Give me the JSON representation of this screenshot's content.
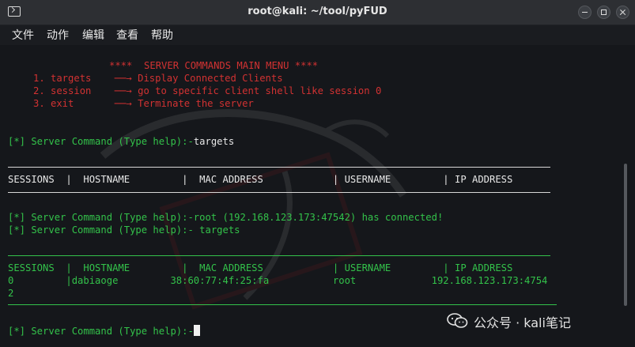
{
  "window": {
    "title": "root@kali: ~/tool/pyFUD"
  },
  "menu": [
    "文件",
    "动作",
    "编辑",
    "查看",
    "帮助"
  ],
  "terminal": {
    "banner": "****  SERVER COMMANDS MAIN MENU ****",
    "menu_options": [
      {
        "label": "1. targets  ",
        "arrow": "──→",
        "desc": "Display Connected Clients"
      },
      {
        "label": "2. session  ",
        "arrow": "──→",
        "desc": "go to specific client shell like session 0"
      },
      {
        "label": "3. exit     ",
        "arrow": "──→",
        "desc": "Terminate the server"
      }
    ],
    "prompt": "[*] Server Command (Type help):-",
    "cmd1": "targets",
    "header_row": "SESSIONS  |  HOSTNAME         |  MAC ADDRESS            | USERNAME         | IP ADDRESS",
    "connected_msg": "[*] Server Command (Type help):-root (192.168.123.173:47542) has connected!",
    "cmd2": " targets",
    "data_row_1": "0         |dabiaoge         38:60:77:4f:25:fa           root             192.168.123.173:4754",
    "data_row_2": "2"
  },
  "watermark": {
    "text": "公众号 · kali笔记",
    "icon": "wechat-icon"
  },
  "colors": {
    "red": "#d23232",
    "green": "#33c24a",
    "background": "#15171b"
  }
}
